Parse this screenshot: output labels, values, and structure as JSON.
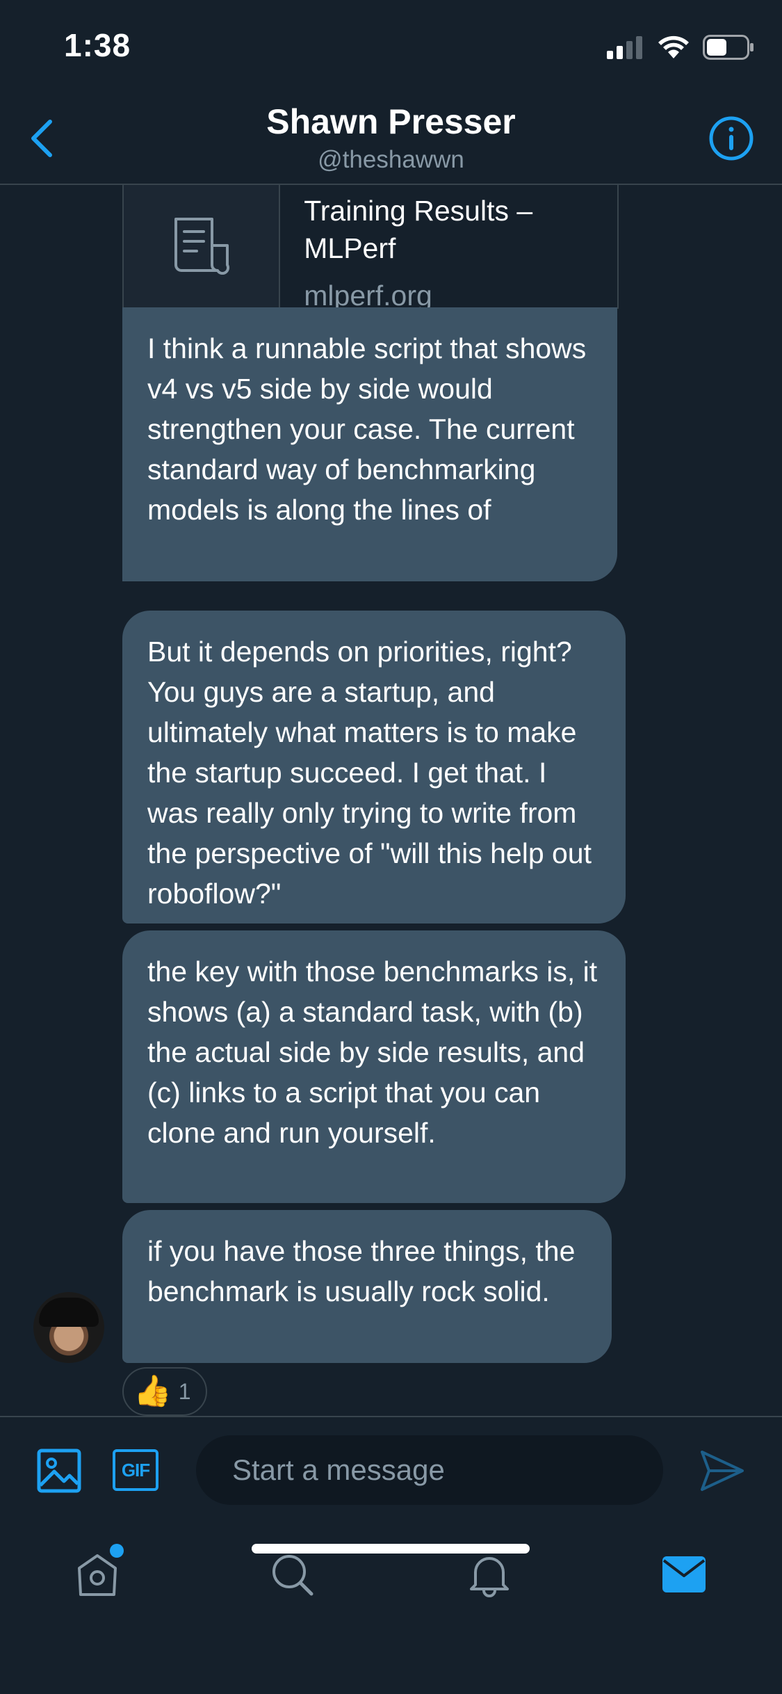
{
  "status_bar": {
    "time": "1:38"
  },
  "header": {
    "title": "Shawn Presser",
    "handle": "@theshawwn"
  },
  "link_card": {
    "title": "Training Results – MLPerf",
    "domain": "mlperf.org",
    "icon": "document-icon"
  },
  "messages": [
    {
      "text": "I think a runnable script that shows v4 vs v5 side by side would strengthen your case. The current standard way of benchmarking models is along the lines of"
    },
    {
      "text": "But it depends on priorities, right? You guys are a startup, and ultimately what matters is to make the startup succeed. I get that. I was really only trying to write from the perspective of \"will this help out roboflow?\""
    },
    {
      "text": "the key with those benchmarks is, it shows (a) a standard task, with (b) the actual side by side results, and (c) links to a script that you can clone and run yourself."
    },
    {
      "text": "if you have those three things, the benchmark is usually rock solid."
    }
  ],
  "reaction": {
    "emoji": "👍",
    "count": "1"
  },
  "composer": {
    "placeholder": "Start a message",
    "gif_label": "GIF"
  },
  "tabs": [
    {
      "name": "home",
      "icon": "home-icon",
      "has_notification_dot": true
    },
    {
      "name": "search",
      "icon": "search-icon"
    },
    {
      "name": "notifications",
      "icon": "bell-icon"
    },
    {
      "name": "messages",
      "icon": "envelope-icon",
      "active": true
    }
  ],
  "colors": {
    "background": "#15202b",
    "bubble": "#3d5466",
    "accent": "#1da1f2",
    "secondary_text": "#8899a6",
    "divider": "#38444d"
  }
}
